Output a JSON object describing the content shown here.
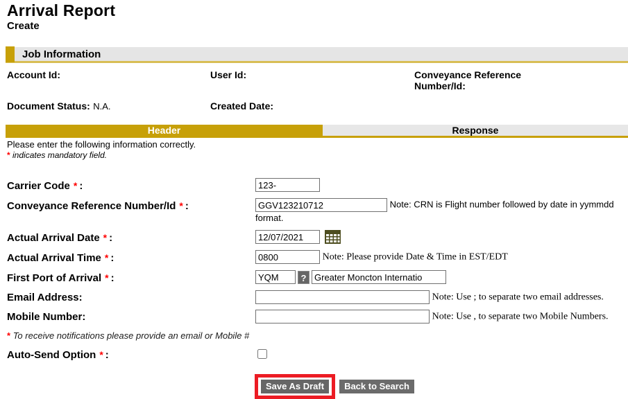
{
  "page": {
    "title": "Arrival Report",
    "subtitle": "Create"
  },
  "ui": {
    "required_marker": "*",
    "label_suffix": ":"
  },
  "job_information": {
    "section_title": "Job Information",
    "account_id_label": "Account Id:",
    "user_id_label": "User Id:",
    "conveyance_ref_label": "Conveyance Reference Number/Id:",
    "document_status_label": "Document Status:",
    "document_status_value": "N.A.",
    "created_date_label": "Created Date:"
  },
  "tabs": [
    {
      "label": "Header",
      "active": true
    },
    {
      "label": "Response",
      "active": false
    }
  ],
  "instructions": {
    "line1": "Please enter the following information correctly.",
    "mandatory_text": "indicates mandatory field."
  },
  "form": {
    "carrier_code": {
      "label": "Carrier Code",
      "value": "123-"
    },
    "conveyance_ref": {
      "label": "Conveyance Reference Number/Id",
      "value": "GGV123210712",
      "note": "Note: CRN is Flight number followed by date in yymmdd format."
    },
    "arrival_date": {
      "label": "Actual Arrival Date",
      "value": "12/07/2021"
    },
    "arrival_time": {
      "label": "Actual Arrival Time",
      "value": "0800",
      "note": "Note: Please provide Date & Time in EST/EDT"
    },
    "first_port": {
      "label": "First Port of Arrival",
      "code_value": "YQM",
      "help_label": "?",
      "name_value": "Greater Moncton Internatio"
    },
    "email": {
      "label": "Email Address",
      "value": "",
      "note": "Note: Use ; to separate two email addresses."
    },
    "mobile": {
      "label": "Mobile Number",
      "value": "",
      "note": "Note: Use , to separate two Mobile Numbers."
    },
    "notification_note": "To receive notifications please provide an email or Mobile #",
    "auto_send": {
      "label": "Auto-Send Option"
    }
  },
  "buttons": {
    "save_as_draft": "Save As Draft",
    "back_to_search": "Back to Search"
  },
  "colors": {
    "gold": "#c7a008",
    "gold_underline": "#d8be55",
    "section_bg": "#e5e5e5",
    "tab_inactive_bg": "#e7e7e7",
    "button_gray": "#666666",
    "highlight_red": "#ec1c24",
    "asterisk_red": "#ff0000"
  }
}
